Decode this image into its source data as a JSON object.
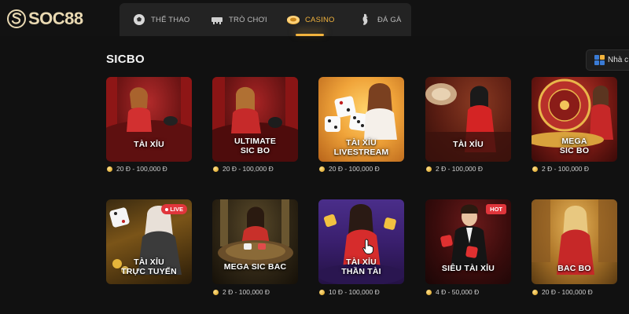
{
  "brand": {
    "logo_text": "SOC88"
  },
  "nav": {
    "items": [
      {
        "label": "THỂ THAO",
        "icon": "soccer-ball-icon"
      },
      {
        "label": "TRÒ CHƠI",
        "icon": "game-controller-icon"
      },
      {
        "label": "CASINO",
        "icon": "casino-chip-icon",
        "active": true
      },
      {
        "label": "ĐÁ GÀ",
        "icon": "rooster-icon"
      }
    ]
  },
  "section": {
    "title": "SICBO"
  },
  "provider_filter": {
    "label": "Nhà c",
    "icon": "grid-icon"
  },
  "games": [
    {
      "title": "TÀI XỈU",
      "price": "20 Đ - 100,000 Đ"
    },
    {
      "title_line1": "ULTIMATE",
      "title_line2": "SIC BO",
      "price": "20 Đ - 100,000 Đ"
    },
    {
      "title_line1": "TÀI XỈU",
      "title_line2": "LIVESTREAM",
      "price": "20 Đ - 100,000 Đ"
    },
    {
      "title": "TÀI XỈU",
      "price": "2 Đ - 100,000 Đ"
    },
    {
      "title_line1": "MEGA",
      "title_line2": "SIC BO",
      "price": "2 Đ - 100,000 Đ"
    },
    {
      "title_line1": "TÀI XỈU",
      "title_line2": "TRỰC TUYẾN",
      "badge": "LIVE",
      "price": ""
    },
    {
      "title": "MEGA SIC BAC",
      "price": "2 Đ - 100,000 Đ"
    },
    {
      "title_line1": "TÀI XỈU",
      "title_line2": "THẦN TÀI",
      "price": "10 Đ - 100,000 Đ"
    },
    {
      "title": "SIÊU TÀI XỈU",
      "badge": "HOT",
      "price": "4 Đ - 50,000 Đ"
    },
    {
      "title": "BAC BO",
      "price": "20 Đ - 100,000 Đ"
    }
  ],
  "colors": {
    "background": "#111111",
    "accent": "#f2b33d",
    "badge_red": "#e0353b"
  }
}
